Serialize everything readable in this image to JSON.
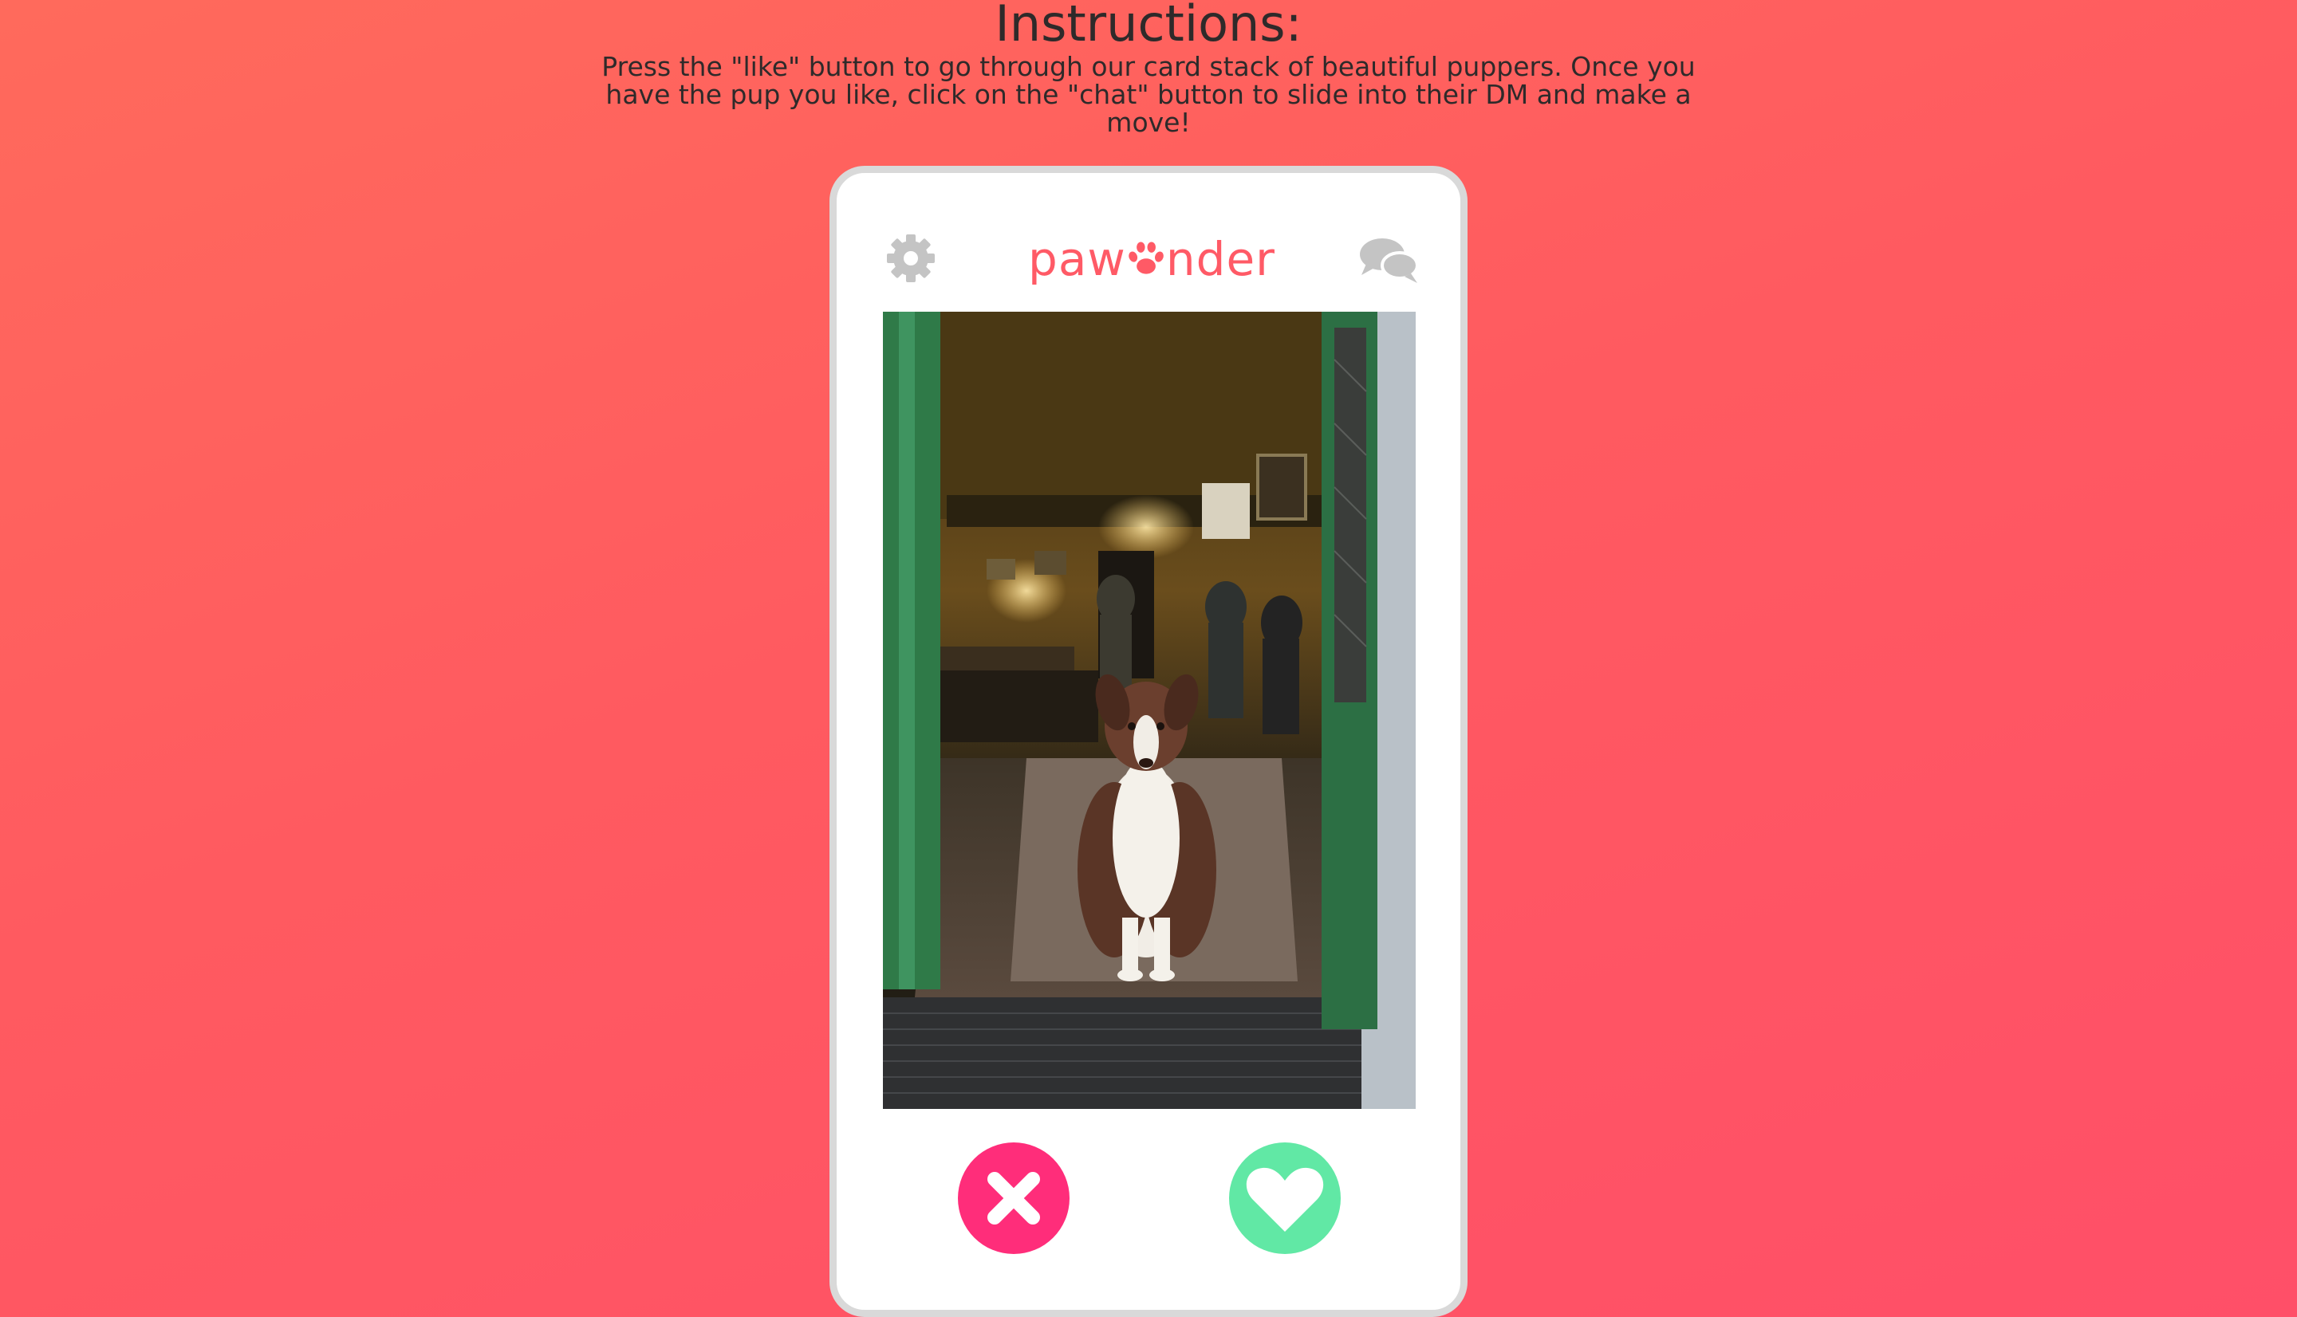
{
  "instructions": {
    "title": "Instructions:",
    "text": "Press the \"like\" button to go through our card stack of beautiful puppers. Once you have the pup you like, click on the \"chat\" button to slide into their DM and make a move!"
  },
  "app": {
    "logo_left": "paw",
    "logo_right": "nder",
    "icons": {
      "settings": "gear-icon",
      "logo_mark": "paw-icon",
      "messages": "chat-bubbles-icon",
      "dislike": "close-icon",
      "like": "heart-icon"
    }
  },
  "card": {
    "photo": "dog-photo"
  },
  "colors": {
    "background": "#ff5a60",
    "brand": "#ff5a66",
    "dislike": "#ff2d7a",
    "like": "#61e8a5",
    "icon_gray": "#c4c4c4"
  }
}
